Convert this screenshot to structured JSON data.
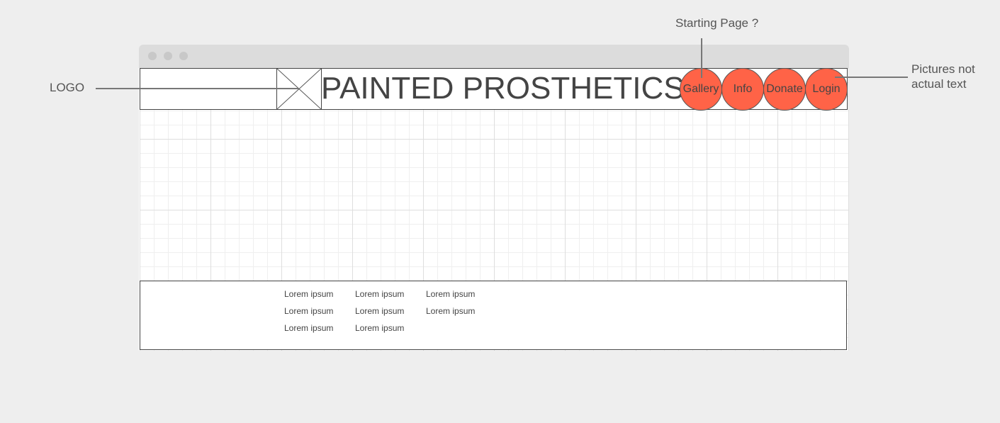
{
  "annotations": {
    "logo": "LOGO",
    "starting_page": "Starting Page ?",
    "pictures_line1": "Pictures not",
    "pictures_line2": "actual text"
  },
  "header": {
    "title": "PAINTED PROSTHETICS",
    "logo_placeholder_icon": "image-placeholder-icon"
  },
  "nav": [
    {
      "label": "Gallery"
    },
    {
      "label": "Info"
    },
    {
      "label": "Donate"
    },
    {
      "label": "Login"
    }
  ],
  "footer": {
    "columns": [
      [
        "Lorem ipsum",
        "Lorem ipsum",
        "Lorem ipsum"
      ],
      [
        "Lorem ipsum",
        "Lorem ipsum",
        "Lorem ipsum"
      ],
      [
        "Lorem ipsum",
        "Lorem ipsum"
      ]
    ]
  },
  "colors": {
    "nav_button": "#ff6347",
    "background": "#eeeeee"
  }
}
